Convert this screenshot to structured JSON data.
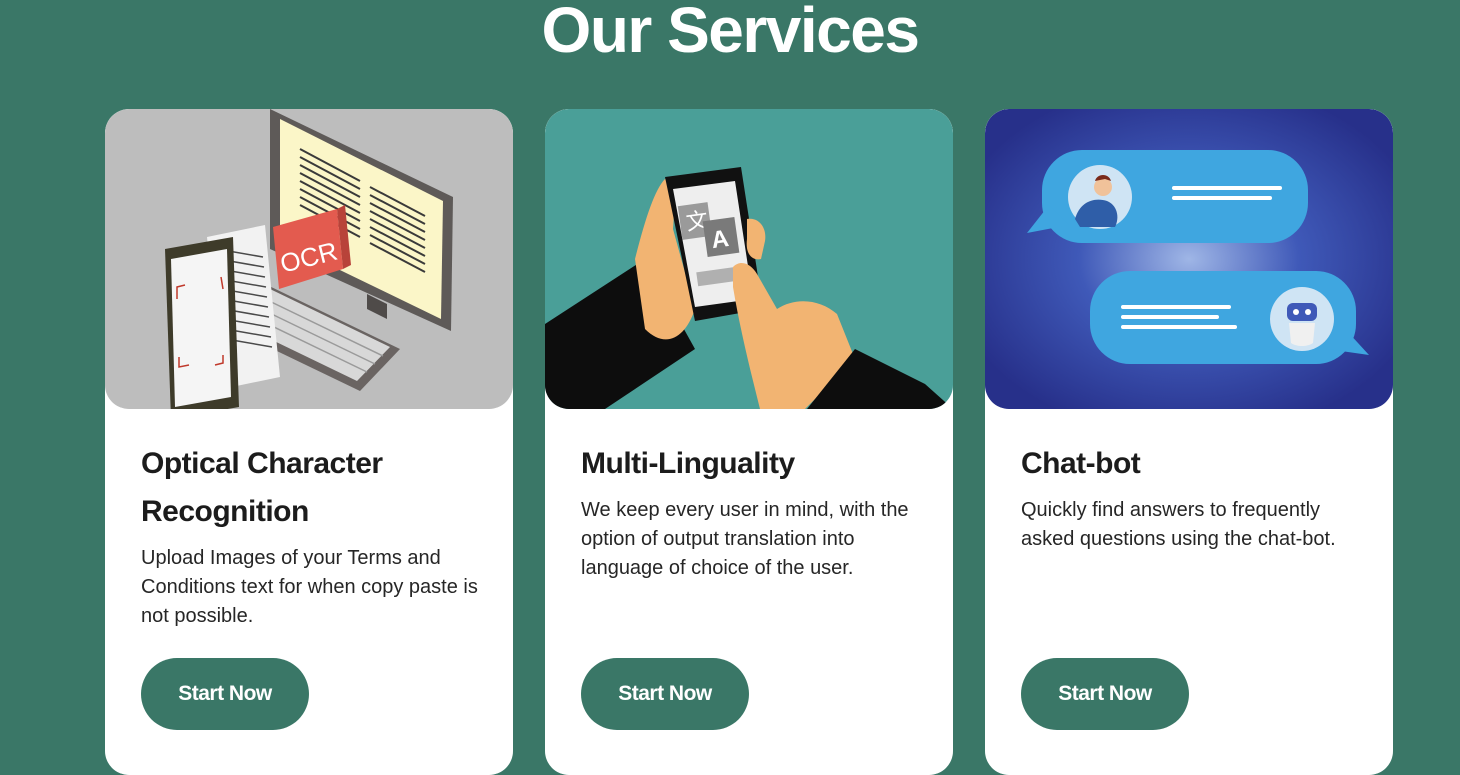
{
  "page": {
    "heading": "Our Services"
  },
  "services": [
    {
      "title": "Optical Character Recognition",
      "description": "Upload Images of your Terms and Conditions text for when copy paste is not possible.",
      "button_label": "Start Now",
      "image_text": "OCR",
      "image_bg": "#bdbdbd"
    },
    {
      "title": "Multi-Linguality",
      "description": "We keep every user in mind, with the option of output translation into language of choice of the user.",
      "button_label": "Start Now",
      "image_text": "A",
      "image_bg": "#4a9f98"
    },
    {
      "title": "Chat-bot",
      "description": "Quickly find answers to frequently asked questions using the chat-bot.",
      "button_label": "Start Now",
      "image_bg": "#2a3a9a"
    }
  ],
  "colors": {
    "background": "#3a7767",
    "button": "#3a7767",
    "card": "#ffffff"
  }
}
